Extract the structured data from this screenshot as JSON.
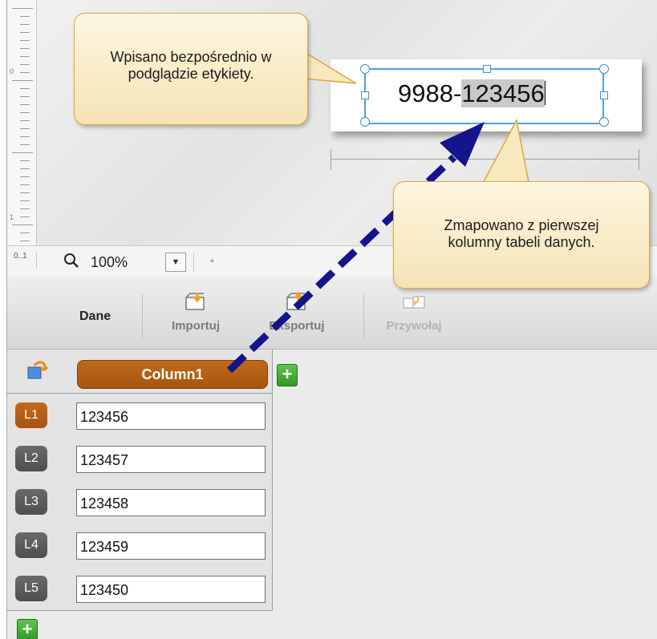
{
  "label": {
    "prefix": "9988-",
    "highlighted": "123456"
  },
  "statusbar": {
    "ruler_icon": "0..1",
    "zoom_icon": "magnifier-icon",
    "zoom": "100%",
    "dropdown_glyph": "▼",
    "scroll_glyph": "◂"
  },
  "ribbon": {
    "group_title": "Dane",
    "buttons": [
      {
        "label": "Importuj",
        "icon": "import-icon",
        "enabled": true
      },
      {
        "label": "Eksportuj",
        "icon": "export-icon",
        "enabled": true
      },
      {
        "label": "Przywołaj",
        "icon": "recall-icon",
        "enabled": false
      }
    ]
  },
  "grid": {
    "corner_icon": "data-source-icon",
    "column": "Column1",
    "add_glyph": "+",
    "rows": [
      {
        "head": "L1",
        "value": "123456",
        "active": true
      },
      {
        "head": "L2",
        "value": "123457",
        "active": false
      },
      {
        "head": "L3",
        "value": "123458",
        "active": false
      },
      {
        "head": "L4",
        "value": "123459",
        "active": false
      },
      {
        "head": "L5",
        "value": "123450",
        "active": false
      }
    ]
  },
  "callouts": {
    "top": "Wpisano bezpośrednio w podglądzie etykiety.",
    "right": "Zmapowano z pierwszej kolumny tabeli danych."
  },
  "colors": {
    "accent_orange": "#b05e14",
    "selection_blue": "#4aa3e8",
    "arrow_navy": "#14148c",
    "add_green": "#3aa82e",
    "callout_fill": "#f7e8bd",
    "callout_border": "#e0a540"
  }
}
